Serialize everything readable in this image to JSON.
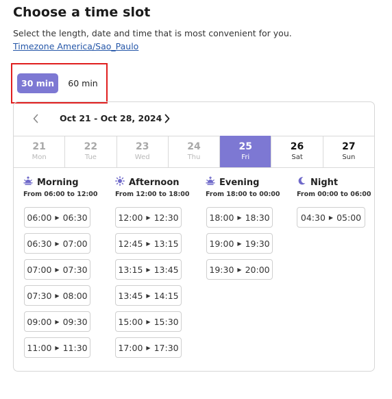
{
  "header": {
    "title": "Choose a time slot",
    "subtitle": "Select the length, date and time that is most convenient for you.",
    "timezone_link": "Timezone America/Sao_Paulo"
  },
  "durations": [
    {
      "label": "30 min",
      "selected": true
    },
    {
      "label": "60 min",
      "selected": false
    }
  ],
  "calendar": {
    "range_label": "Oct 21 - Oct 28, 2024",
    "days": [
      {
        "num": "21",
        "weekday": "Mon",
        "state": "disabled"
      },
      {
        "num": "22",
        "weekday": "Tue",
        "state": "disabled"
      },
      {
        "num": "23",
        "weekday": "Wed",
        "state": "disabled"
      },
      {
        "num": "24",
        "weekday": "Thu",
        "state": "disabled"
      },
      {
        "num": "25",
        "weekday": "Fri",
        "state": "selected"
      },
      {
        "num": "26",
        "weekday": "Sat",
        "state": "active"
      },
      {
        "num": "27",
        "weekday": "Sun",
        "state": "active"
      }
    ]
  },
  "periods": [
    {
      "name": "Morning",
      "icon": "sunrise-icon",
      "range": "From 06:00 to 12:00",
      "slots": [
        {
          "start": "06:00",
          "end": "06:30"
        },
        {
          "start": "06:30",
          "end": "07:00"
        },
        {
          "start": "07:00",
          "end": "07:30"
        },
        {
          "start": "07:30",
          "end": "08:00"
        },
        {
          "start": "09:00",
          "end": "09:30"
        },
        {
          "start": "11:00",
          "end": "11:30"
        }
      ]
    },
    {
      "name": "Afternoon",
      "icon": "sun-icon",
      "range": "From 12:00 to 18:00",
      "slots": [
        {
          "start": "12:00",
          "end": "12:30"
        },
        {
          "start": "12:45",
          "end": "13:15"
        },
        {
          "start": "13:15",
          "end": "13:45"
        },
        {
          "start": "13:45",
          "end": "14:15"
        },
        {
          "start": "15:00",
          "end": "15:30"
        },
        {
          "start": "17:00",
          "end": "17:30"
        }
      ]
    },
    {
      "name": "Evening",
      "icon": "sunset-icon",
      "range": "From 18:00 to 00:00",
      "slots": [
        {
          "start": "18:00",
          "end": "18:30"
        },
        {
          "start": "19:00",
          "end": "19:30"
        },
        {
          "start": "19:30",
          "end": "20:00"
        }
      ]
    },
    {
      "name": "Night",
      "icon": "moon-icon",
      "range": "From 00:00 to 06:00",
      "slots": [
        {
          "start": "04:30",
          "end": "05:00"
        }
      ]
    }
  ],
  "colors": {
    "accent": "#7d78d3",
    "highlight_border": "#e01e1e",
    "link": "#2456a8"
  }
}
